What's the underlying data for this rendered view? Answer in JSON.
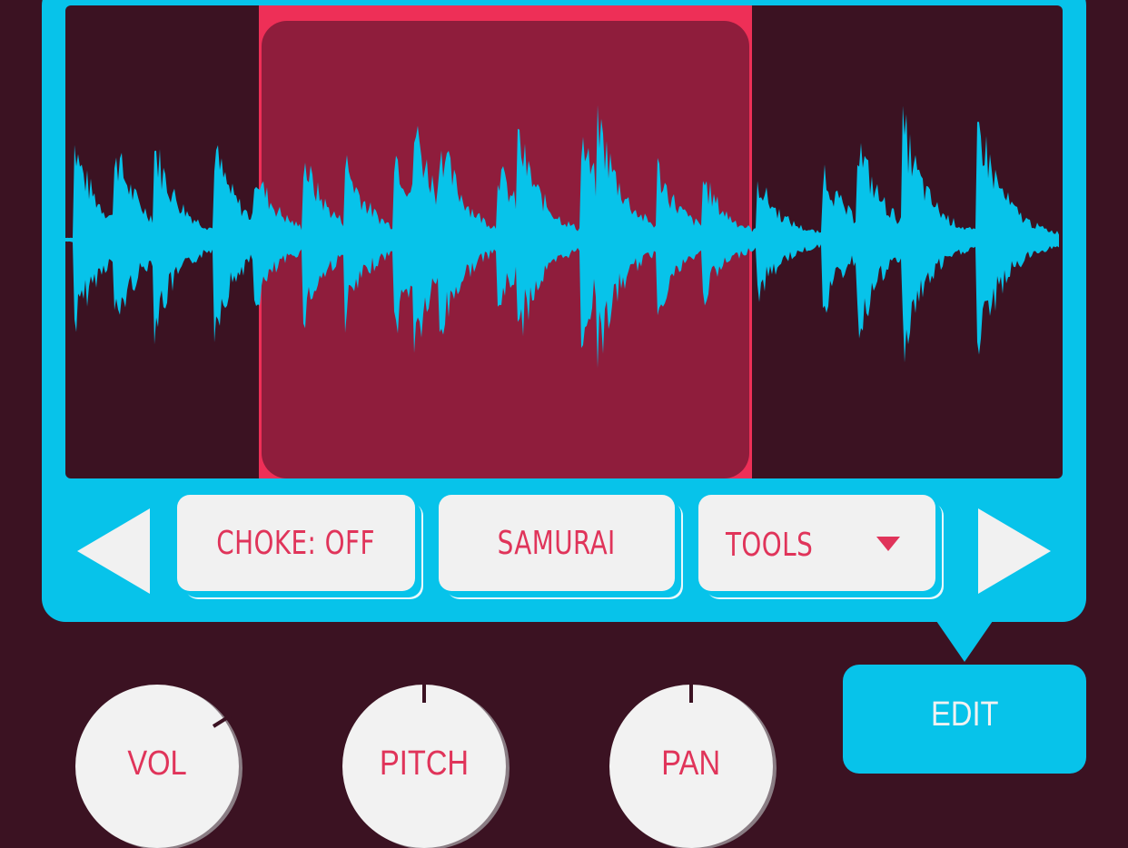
{
  "editor": {
    "choke_label": "CHOKE: OFF",
    "kit_label": "SAMURAI",
    "tools_label": "TOOLS",
    "edit_label": "EDIT"
  },
  "knobs": [
    {
      "label": "VOL"
    },
    {
      "label": "PITCH"
    },
    {
      "label": "PAN"
    }
  ],
  "colors": {
    "background": "#3b1222",
    "accent": "#07c3ea",
    "selection": "#ee2f57",
    "selection_fill": "#8f1d3c",
    "label": "#e0345a",
    "button": "#f1f1f1"
  },
  "icons": {
    "prev": "triangle-left",
    "next": "triangle-right",
    "dropdown": "triangle-down"
  }
}
